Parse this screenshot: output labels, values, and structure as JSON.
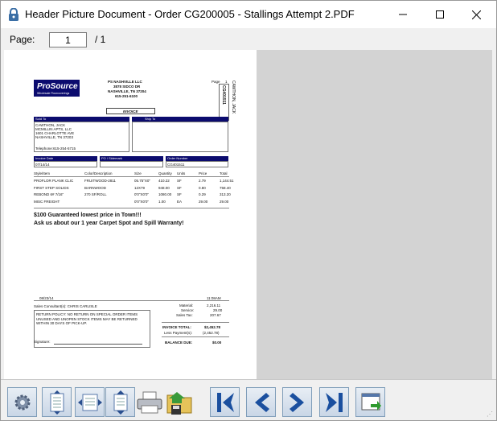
{
  "window": {
    "title": "Header Picture Document - Order CG200005 - Stallings Attempt 2.PDF"
  },
  "pager": {
    "label": "Page:",
    "current": "1",
    "total": "/ 1"
  },
  "doc": {
    "company": "PS NASHVILLE LLC",
    "address1": "3878 SIDCO DR",
    "address2": "NASHVILLE, TN  37204",
    "phone": "615-251-6100",
    "page_label": "Page",
    "page_num": "1",
    "side_name": "CAWTHON, JACK",
    "side_order": "CG401511",
    "logo_main": "ProSource",
    "logo_sub": "Wholesale Floorcoverings",
    "invoice": "INVOICE",
    "sold_to": "Sold To",
    "ship_to": "Ship To",
    "sold_lines": [
      "CAWTHON, JACK",
      "MCMILLIN APTS, LLC",
      "1601 CHARLOTTE AVE",
      "NASHVILLE, TN  37203",
      "",
      "Telephone:615-254-5715"
    ],
    "invoice_date_label": "Invoice Date",
    "invoice_date": "07/14/14",
    "po_label": "PO / Sidemark",
    "order_label": "Order Number",
    "order_number": "CG401511",
    "cols": [
      "Style/Item",
      "Color/Description",
      "Size",
      "Quantity",
      "Units",
      "Price",
      "Total"
    ],
    "rows": [
      [
        "PROFLOR PLANK CLIC",
        "FRUITWOOD-2811",
        "05.75\"X0\"",
        "410.22",
        "SF",
        "2.79",
        "1,144.51"
      ],
      [
        "FIRST STEP SOLIDS",
        "BARNWOOD",
        "12X79",
        "948.00",
        "SF",
        "0.80",
        "758.40"
      ],
      [
        "REBOND 6# 7/16\"",
        "270 SF/ROLL",
        "0'0\"X0'0\"",
        "1080.00",
        "SF",
        "0.29",
        "313.20"
      ],
      [
        "MISC FREIGHT",
        "",
        "0'0\"X0'0\"",
        "1.00",
        "EA",
        "29.00",
        "29.00"
      ]
    ],
    "promo1": "$100 Guaranteed lowest price in Town!!!",
    "promo2": "Ask us about our 1 year Carpet Spot and Spill Warranty!",
    "date": "08/23/14",
    "time": "11:08AM",
    "consultant": "Sales Consultant(s): CHRIS CARLISLE",
    "policy": "RETURN POLICY: NO RETURN ON SPECIAL ORDER ITEMS UNUSED AND UNOPEN STOCK ITEMS MAY BE RETURNED WITHIN 30 DAYS OF PICK-UP.",
    "signature": "Signature:",
    "material_label": "Material:",
    "material": "2,216.11",
    "service_label": "Service:",
    "service": "29.00",
    "tax_label": "Sales Tax:",
    "tax": "207.67",
    "total_label": "INVOICE TOTAL:",
    "total": "$2,452.78",
    "payment_label": "Less Payment(s):",
    "payment": "(2,452.78)",
    "due_label": "BALANCE DUE:",
    "due": "$0.00"
  },
  "toolbar": [
    "gear-icon",
    "fit-page-icon",
    "fit-width-icon",
    "fit-height-icon",
    "print-icon",
    "save-icon",
    "first-page-icon",
    "previous-page-icon",
    "next-page-icon",
    "last-page-icon",
    "export-icon"
  ]
}
